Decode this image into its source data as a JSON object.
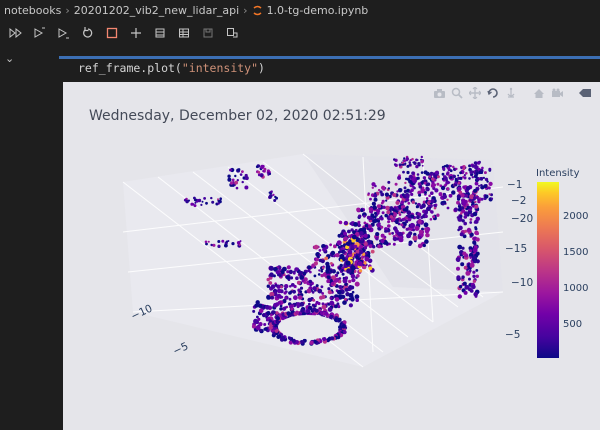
{
  "breadcrumb": {
    "items": [
      "notebooks",
      "20201202_vib2_new_lidar_api",
      "1.0-tg-demo.ipynb"
    ]
  },
  "toolbar": {
    "buttons": [
      "run-all-icon",
      "run-above-icon",
      "run-below-icon",
      "restart-icon",
      "stop-icon",
      "add-icon",
      "clear-outputs-icon",
      "variables-icon",
      "save-icon",
      "export-icon"
    ]
  },
  "cell": {
    "code_prefix": "ref_frame.plot(",
    "code_string": "\"intensity\"",
    "code_suffix": ")"
  },
  "plot": {
    "title": "Wednesday, December 02, 2020 02:51:29",
    "modebar": [
      "camera-icon",
      "zoom-icon",
      "pan-icon",
      "orbit-icon",
      "turntable-icon",
      "reset-icon",
      "video-icon",
      "toggle-icon"
    ]
  },
  "chart_data": {
    "type": "scatter",
    "title": "Wednesday, December 02, 2020 02:51:29",
    "dimensions": 3,
    "axis_ticks_left": [
      "−10",
      "−5"
    ],
    "axis_ticks_right": [
      "−1",
      "−2",
      "−20",
      "−15",
      "−10",
      "−5"
    ],
    "colorbar": {
      "title": "Intensity",
      "ticks": [
        "2000",
        "1500",
        "1000",
        "500"
      ],
      "range": [
        0,
        2500
      ],
      "colorscale": "Plasma"
    },
    "colors": {
      "low": "#0d0887",
      "mid": "#9c179e",
      "high": "#f0f921"
    }
  }
}
